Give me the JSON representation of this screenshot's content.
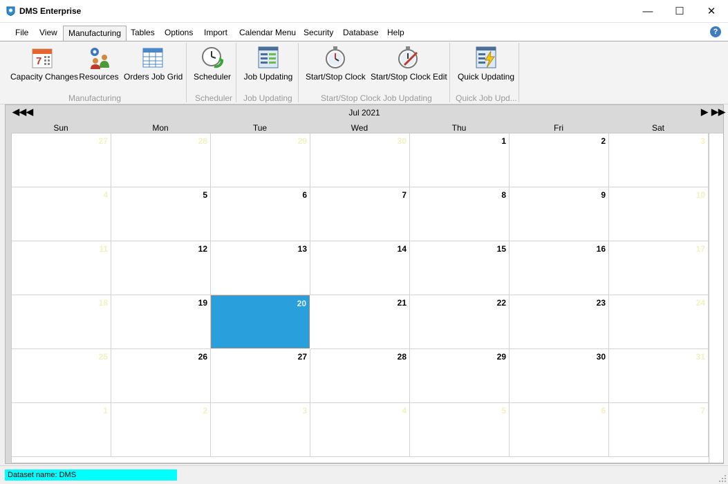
{
  "window": {
    "title": "DMS Enterprise",
    "minimize_glyph": "—",
    "maximize_glyph": "☐",
    "close_glyph": "✕"
  },
  "menu": {
    "items": [
      {
        "label": "File"
      },
      {
        "label": "View"
      },
      {
        "label": "Manufacturing",
        "active": true
      },
      {
        "label": "Tables"
      },
      {
        "label": "Options"
      },
      {
        "label": "Import"
      },
      {
        "label": "Calendar Menu"
      },
      {
        "label": "Security"
      },
      {
        "label": "Database"
      },
      {
        "label": "Help"
      }
    ],
    "help_glyph": "?"
  },
  "ribbon": {
    "buttons": [
      {
        "label": "Capacity Changes",
        "icon": "calendar-icon"
      },
      {
        "label": "Resources",
        "icon": "people-gear-icon"
      },
      {
        "label": "Orders Job Grid",
        "icon": "grid-icon"
      },
      {
        "label": "Scheduler",
        "icon": "clock-refresh-icon"
      },
      {
        "label": "Job Updating",
        "icon": "form-icon"
      },
      {
        "label": "Start/Stop Clock",
        "icon": "stopwatch-icon"
      },
      {
        "label": "Start/Stop Clock Edit",
        "icon": "stopwatch-edit-icon"
      },
      {
        "label": "Quick Updating",
        "icon": "form-lightning-icon"
      }
    ],
    "groups": [
      {
        "label": "Manufacturing"
      },
      {
        "label": "Scheduler"
      },
      {
        "label": "Job Updating"
      },
      {
        "label": "Start/Stop Clock Job Updating"
      },
      {
        "label": "Quick Job Upd..."
      }
    ]
  },
  "calendar": {
    "month_title": "Jul 2021",
    "nav": {
      "first": "◀◀",
      "prev": "◀",
      "next": "▶",
      "last": "▶▶"
    },
    "weekdays": [
      "Sun",
      "Mon",
      "Tue",
      "Wed",
      "Thu",
      "Fri",
      "Sat"
    ],
    "weeks": [
      [
        {
          "day": "27",
          "other": true
        },
        {
          "day": "28",
          "other": true
        },
        {
          "day": "29",
          "other": true
        },
        {
          "day": "30",
          "other": true
        },
        {
          "day": "1"
        },
        {
          "day": "2"
        },
        {
          "day": "3",
          "weekend": true
        }
      ],
      [
        {
          "day": "4",
          "weekend": true
        },
        {
          "day": "5"
        },
        {
          "day": "6"
        },
        {
          "day": "7"
        },
        {
          "day": "8"
        },
        {
          "day": "9"
        },
        {
          "day": "10",
          "weekend": true
        }
      ],
      [
        {
          "day": "11",
          "weekend": true
        },
        {
          "day": "12"
        },
        {
          "day": "13"
        },
        {
          "day": "14"
        },
        {
          "day": "15"
        },
        {
          "day": "16"
        },
        {
          "day": "17",
          "weekend": true
        }
      ],
      [
        {
          "day": "18",
          "weekend": true
        },
        {
          "day": "19"
        },
        {
          "day": "20",
          "today": true
        },
        {
          "day": "21"
        },
        {
          "day": "22"
        },
        {
          "day": "23"
        },
        {
          "day": "24",
          "weekend": true
        }
      ],
      [
        {
          "day": "25",
          "weekend": true
        },
        {
          "day": "26"
        },
        {
          "day": "27"
        },
        {
          "day": "28"
        },
        {
          "day": "29"
        },
        {
          "day": "30"
        },
        {
          "day": "31",
          "weekend": true
        }
      ],
      [
        {
          "day": "1",
          "other": true
        },
        {
          "day": "2",
          "other": true
        },
        {
          "day": "3",
          "other": true
        },
        {
          "day": "4",
          "other": true
        },
        {
          "day": "5",
          "other": true
        },
        {
          "day": "6",
          "other": true
        },
        {
          "day": "7",
          "other": true
        }
      ]
    ],
    "colors": {
      "today": "#29a0db",
      "muted_day": "#f2f2c0"
    }
  },
  "status": {
    "dataset_label": "Dataset name:",
    "dataset_value": "DMS"
  }
}
